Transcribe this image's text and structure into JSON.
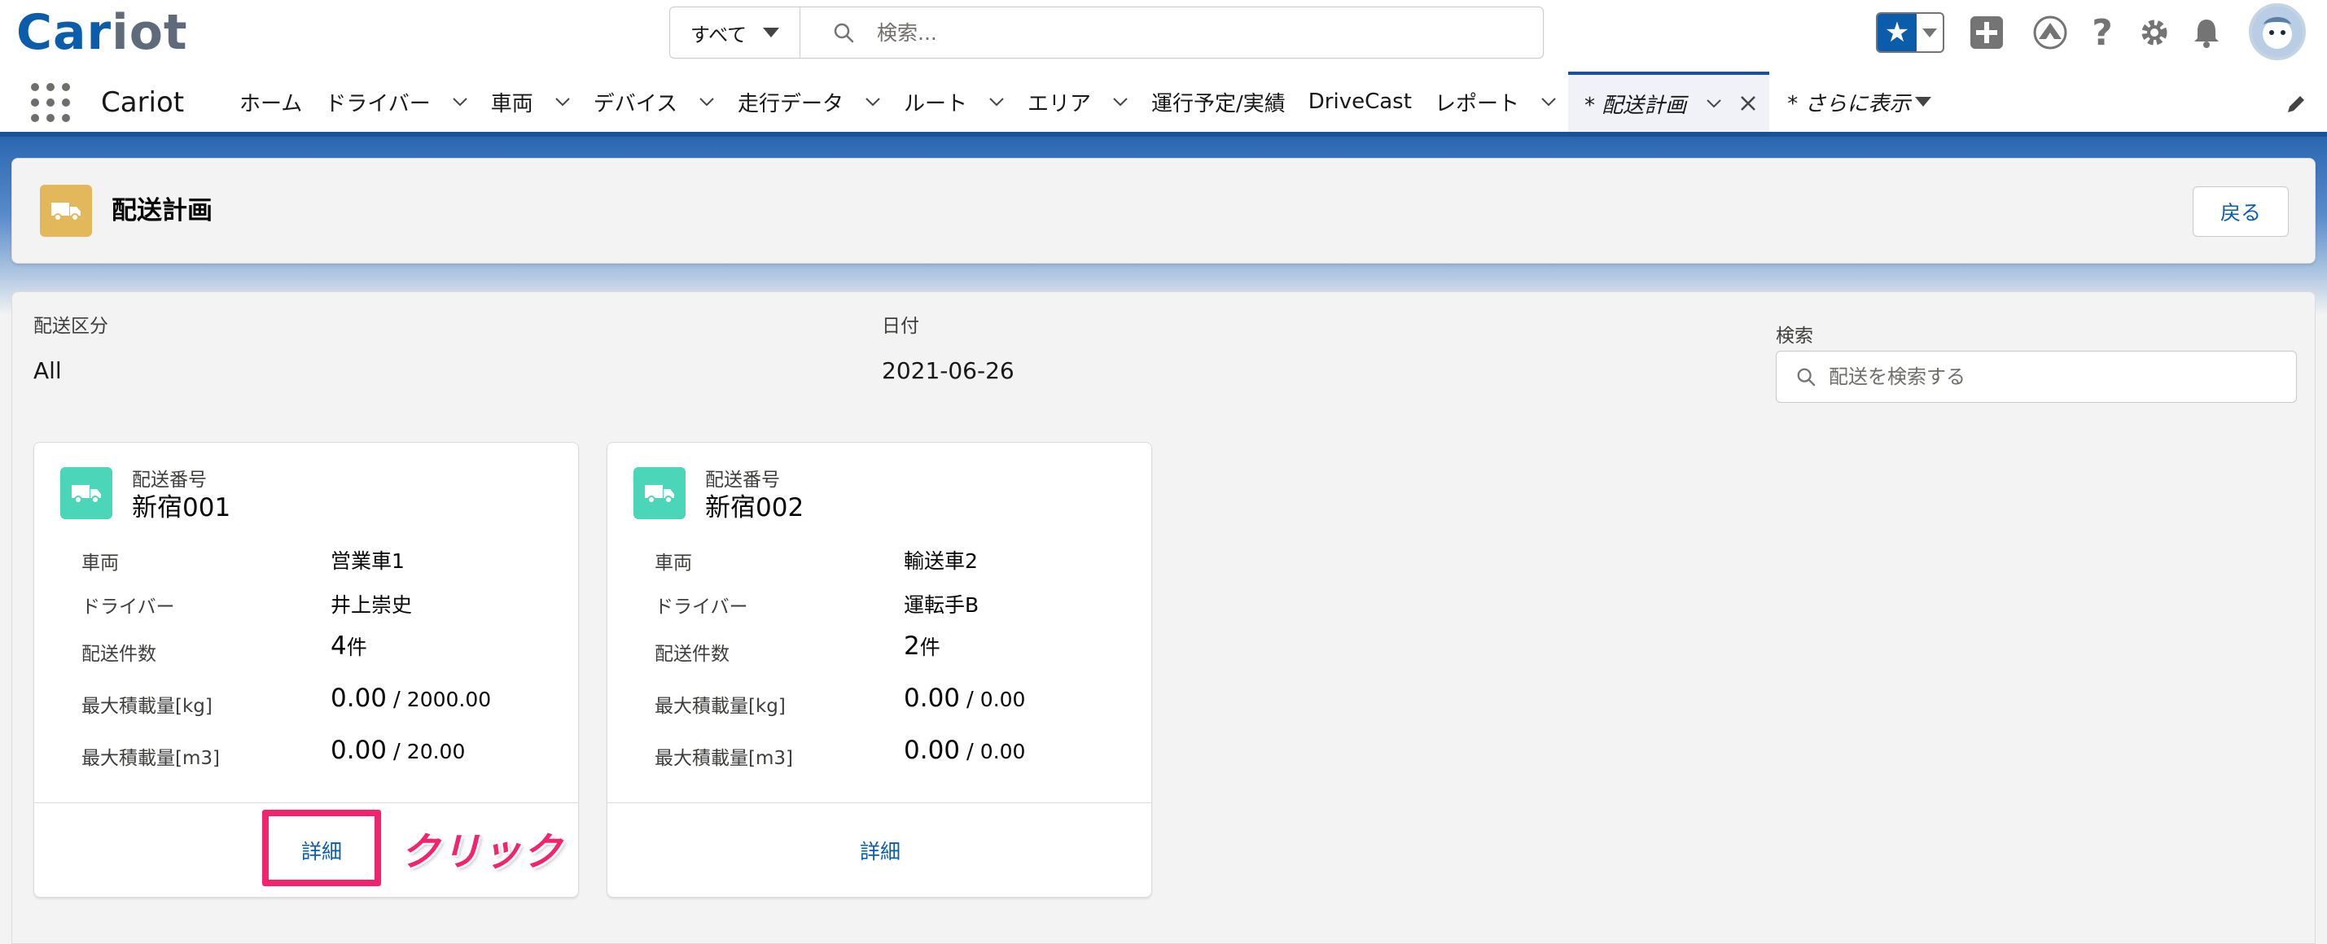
{
  "header": {
    "logo_part1": "Car",
    "logo_part2": "iot",
    "search_scope": "すべて",
    "search_placeholder": "検索...",
    "icons": [
      "star-icon",
      "add-icon",
      "trailhead-icon",
      "help-icon",
      "setup-gear-icon",
      "notification-bell-icon",
      "avatar"
    ]
  },
  "nav": {
    "app_name": "Cariot",
    "items": [
      {
        "label": "ホーム",
        "caret": false
      },
      {
        "label": "ドライバー",
        "caret": true
      },
      {
        "label": "車両",
        "caret": true
      },
      {
        "label": "デバイス",
        "caret": true
      },
      {
        "label": "走行データ",
        "caret": true
      },
      {
        "label": "ルート",
        "caret": true
      },
      {
        "label": "エリア",
        "caret": true
      },
      {
        "label": "運行予定/実績",
        "caret": false
      },
      {
        "label": "DriveCast",
        "caret": false
      },
      {
        "label": "レポート",
        "caret": true
      }
    ],
    "active_tab": "* 配送計画",
    "more": "* さらに表示"
  },
  "page": {
    "title": "配送計画",
    "back_label": "戻る"
  },
  "filters": {
    "type_label": "配送区分",
    "type_value": "All",
    "date_label": "日付",
    "date_value": "2021-06-26",
    "search_label": "検索",
    "search_placeholder": "配送を検索する"
  },
  "cards": [
    {
      "subtitle": "配送番号",
      "title": "新宿001",
      "vehicle_label": "車両",
      "vehicle": "営業車1",
      "driver_label": "ドライバー",
      "driver": "井上崇史",
      "count_label": "配送件数",
      "count": "4",
      "count_unit": "件",
      "weight_label": "最大積載量[kg]",
      "weight": "0.00",
      "weight_max": "2000.00",
      "volume_label": "最大積載量[m3]",
      "volume": "0.00",
      "volume_max": "20.00",
      "detail_label": "詳細"
    },
    {
      "subtitle": "配送番号",
      "title": "新宿002",
      "vehicle_label": "車両",
      "vehicle": "輸送車2",
      "driver_label": "ドライバー",
      "driver": "運転手B",
      "count_label": "配送件数",
      "count": "2",
      "count_unit": "件",
      "weight_label": "最大積載量[kg]",
      "weight": "0.00",
      "weight_max": "0.00",
      "volume_label": "最大積載量[m3]",
      "volume": "0.00",
      "volume_max": "0.00",
      "detail_label": "詳細"
    }
  ],
  "annotation": {
    "click_text": "クリック",
    "color": "#f3236d"
  },
  "colors": {
    "brand_blue": "#0b5cab",
    "nav_accent": "#1b5297",
    "object_icon": "#e3b85b",
    "card_icon": "#4bd6b9"
  }
}
